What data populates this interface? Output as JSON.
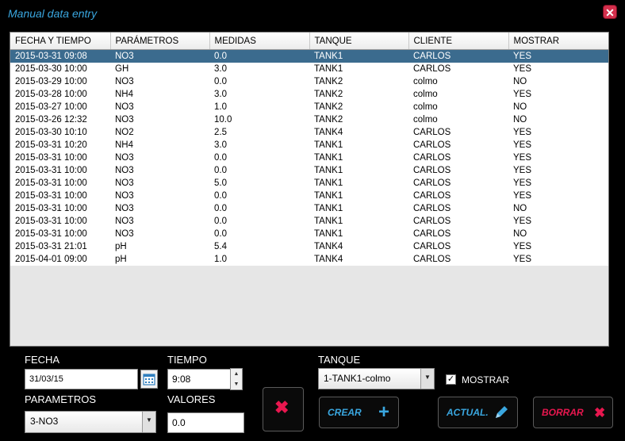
{
  "window": {
    "title": "Manual data entry"
  },
  "table": {
    "columns": [
      "FECHA Y TIEMPO",
      "PARÁMETROS",
      "MEDIDAS",
      "TANQUE",
      "CLIENTE",
      "MOSTRAR"
    ],
    "rows": [
      [
        "2015-03-31 09:08",
        "NO3",
        "0.0",
        "TANK1",
        "CARLOS",
        "YES"
      ],
      [
        "2015-03-30 10:00",
        "GH",
        "3.0",
        "TANK1",
        "CARLOS",
        "YES"
      ],
      [
        "2015-03-29 10:00",
        "NO3",
        "0.0",
        "TANK2",
        "colmo",
        "NO"
      ],
      [
        "2015-03-28 10:00",
        "NH4",
        "3.0",
        "TANK2",
        "colmo",
        "YES"
      ],
      [
        "2015-03-27 10:00",
        "NO3",
        "1.0",
        "TANK2",
        "colmo",
        "NO"
      ],
      [
        "2015-03-26 12:32",
        "NO3",
        "10.0",
        "TANK2",
        "colmo",
        "NO"
      ],
      [
        "2015-03-30 10:10",
        "NO2",
        "2.5",
        "TANK4",
        "CARLOS",
        "YES"
      ],
      [
        "2015-03-31 10:20",
        "NH4",
        "3.0",
        "TANK1",
        "CARLOS",
        "YES"
      ],
      [
        "2015-03-31 10:00",
        "NO3",
        "0.0",
        "TANK1",
        "CARLOS",
        "YES"
      ],
      [
        "2015-03-31 10:00",
        "NO3",
        "0.0",
        "TANK1",
        "CARLOS",
        "YES"
      ],
      [
        "2015-03-31 10:00",
        "NO3",
        "5.0",
        "TANK1",
        "CARLOS",
        "YES"
      ],
      [
        "2015-03-31 10:00",
        "NO3",
        "0.0",
        "TANK1",
        "CARLOS",
        "YES"
      ],
      [
        "2015-03-31 10:00",
        "NO3",
        "0.0",
        "TANK1",
        "CARLOS",
        "NO"
      ],
      [
        "2015-03-31 10:00",
        "NO3",
        "0.0",
        "TANK1",
        "CARLOS",
        "YES"
      ],
      [
        "2015-03-31 10:00",
        "NO3",
        "0.0",
        "TANK1",
        "CARLOS",
        "NO"
      ],
      [
        "2015-03-31 21:01",
        "pH",
        "5.4",
        "TANK4",
        "CARLOS",
        "YES"
      ],
      [
        "2015-04-01 09:00",
        "pH",
        "1.0",
        "TANK4",
        "CARLOS",
        "YES"
      ]
    ],
    "selected_row": 0
  },
  "form": {
    "fecha_label": "FECHA",
    "fecha_value": "31/03/15",
    "tiempo_label": "TIEMPO",
    "tiempo_value": "9:08",
    "parametros_label": "PARAMETROS",
    "parametros_value": "3-NO3",
    "valores_label": "VALORES",
    "valores_value": "0.0",
    "tanque_label": "TANQUE",
    "tanque_value": "1-TANK1-colmo",
    "mostrar_label": "MOSTRAR",
    "mostrar_checked": true
  },
  "buttons": {
    "crear": "CREAR",
    "actual": "ACTUAL.",
    "borrar": "BORRAR"
  },
  "colors": {
    "accent": "#3aa7e0",
    "danger": "#e8174f",
    "selected_row": "#3b6b8e"
  }
}
